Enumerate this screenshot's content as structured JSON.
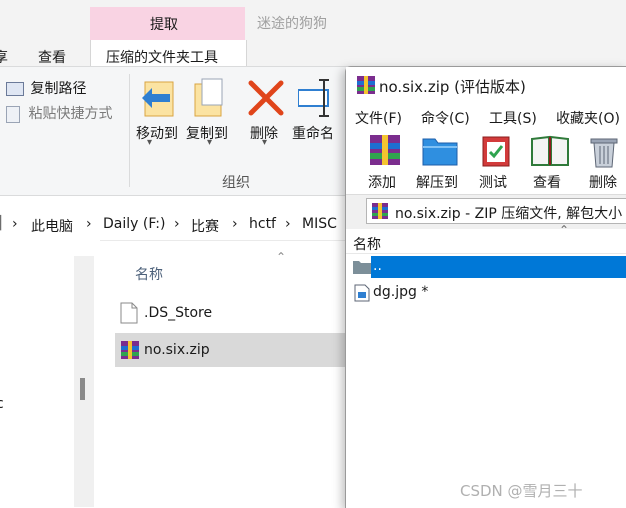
{
  "explorer": {
    "tabs": {
      "partial_left": "享",
      "view": "查看"
    },
    "context_tab": {
      "header": "提取",
      "label": "压缩的文件夹工具"
    },
    "window_title": "迷途的狗狗",
    "clipboard": {
      "copy_path": "复制路径",
      "paste_shortcut": "粘贴快捷方式"
    },
    "organize": {
      "move_to": "移动到",
      "copy_to": "复制到",
      "delete": "删除",
      "rename": "重命名",
      "group_label": "组织"
    },
    "breadcrumb": [
      "此电脑",
      "Daily (F:)",
      "比赛",
      "hctf",
      "MISC"
    ],
    "column_name": "名称",
    "files": [
      ".DS_Store",
      "no.six.zip"
    ],
    "nav_partial": "c"
  },
  "winrar": {
    "title": "no.six.zip (评估版本)",
    "menu": [
      "文件(F)",
      "命令(C)",
      "工具(S)",
      "收藏夹(O)"
    ],
    "toolbar": [
      "添加",
      "解压到",
      "测试",
      "查看",
      "删除"
    ],
    "path": "no.six.zip - ZIP 压缩文件, 解包大小",
    "column_name": "名称",
    "entries": [
      "..",
      "dg.jpg *"
    ]
  },
  "watermark": "CSDN @雪月三十",
  "colors": {
    "context_tab": "#f9d3e3",
    "selection": "#0078d7",
    "row_hover": "#d9d9d9"
  }
}
